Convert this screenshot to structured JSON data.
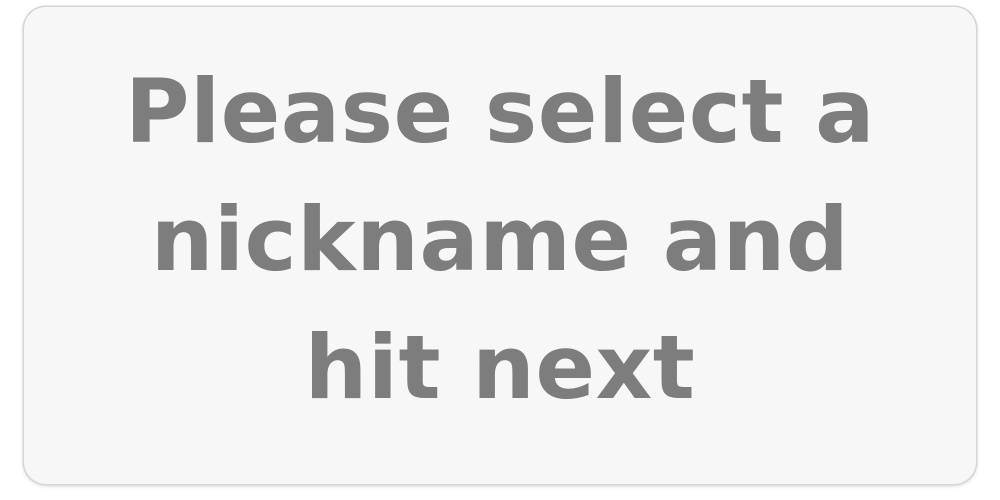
{
  "dialog": {
    "message_lines": [
      "Please select a",
      "nickname and",
      "hit next"
    ]
  }
}
